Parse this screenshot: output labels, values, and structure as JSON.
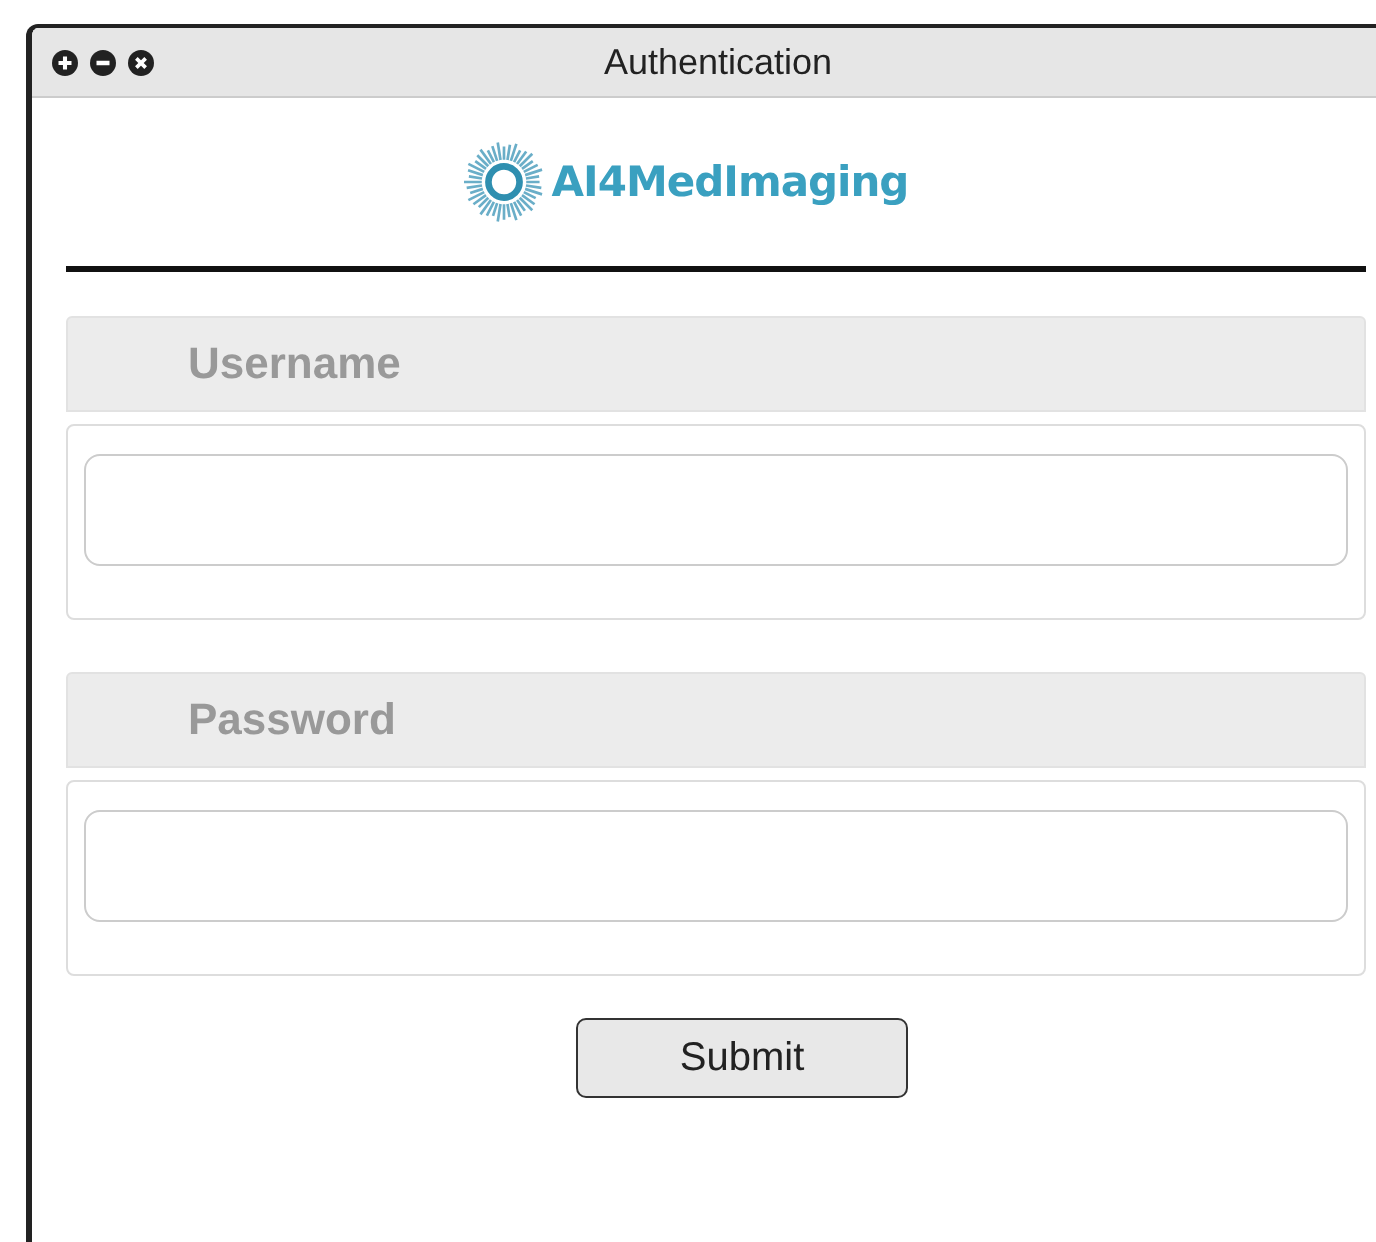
{
  "window": {
    "title": "Authentication",
    "controls": [
      {
        "kind": "add"
      },
      {
        "kind": "minimize"
      },
      {
        "kind": "close"
      }
    ]
  },
  "logo": {
    "text": "AI4MedImaging"
  },
  "fields": [
    {
      "label": "Username"
    },
    {
      "label": "Password"
    }
  ],
  "buttons": [
    {
      "label": "Submit"
    }
  ]
}
